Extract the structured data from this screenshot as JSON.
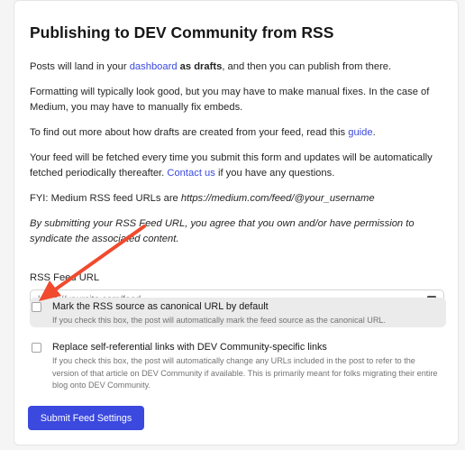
{
  "title": "Publishing to DEV Community from RSS",
  "para1": {
    "pre": "Posts will land in your ",
    "link": "dashboard",
    "mid": " ",
    "bold": "as drafts",
    "post": ", and then you can publish from there."
  },
  "para2": "Formatting will typically look good, but you may have to make manual fixes. In the case of Medium, you may have to manually fix embeds.",
  "para3": {
    "pre": "To find out more about how drafts are created from your feed, read this ",
    "link": "guide",
    "post": "."
  },
  "para4": {
    "pre": "Your feed will be fetched every time you submit this form and updates will be automatically fetched periodically thereafter. ",
    "link": "Contact us",
    "post": " if you have any questions."
  },
  "para5": {
    "pre": "FYI: Medium RSS feed URLs are ",
    "em": "https://medium.com/feed/@your_username"
  },
  "para6": "By submitting your RSS Feed URL, you agree that you own and/or have permission to syndicate the associated content.",
  "feed_url": {
    "label": "RSS Feed URL",
    "placeholder": "https://yoursite.com/feed",
    "value": ""
  },
  "canonical": {
    "label": "Mark the RSS source as canonical URL by default",
    "description": "If you check this box, the post will automatically mark the feed source as the canonical URL.",
    "checked": false
  },
  "replace_links": {
    "label": "Replace self-referential links with DEV Community-specific links",
    "description": "If you check this box, the post will automatically change any URLs included in the post to refer to the version of that article on DEV Community if available. This is primarily meant for folks migrating their entire blog onto DEV Community.",
    "checked": false
  },
  "submit_label": "Submit Feed Settings",
  "colors": {
    "accent": "#3b49df",
    "arrow": "#f04a2f"
  }
}
